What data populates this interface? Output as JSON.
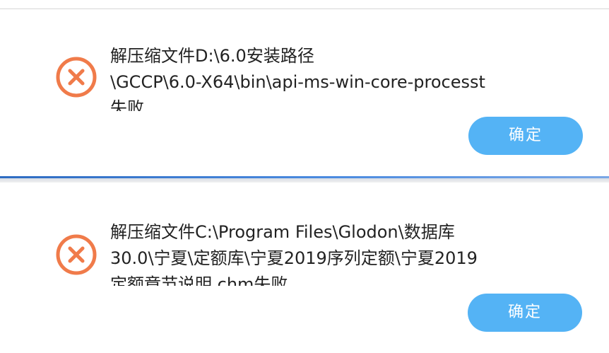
{
  "dialogs": [
    {
      "icon": "error-icon",
      "message_lines": [
        "解压缩文件D:\\6.0安装路径",
        "\\GCCP\\6.0-X64\\bin\\api-ms-win-core-processt",
        "失败"
      ],
      "button_label": "确定"
    },
    {
      "icon": "error-icon",
      "message_lines": [
        "解压缩文件C:\\Program Files\\Glodon\\数据库",
        "30.0\\宁夏\\定额库\\宁夏2019序列定额\\宁夏2019",
        "定额章节说明.chm失败"
      ],
      "button_label": "确定"
    }
  ],
  "colors": {
    "error_icon": "#f07b4a",
    "button": "#54b3f5",
    "button_text": "#ffffff",
    "text": "#222222"
  }
}
